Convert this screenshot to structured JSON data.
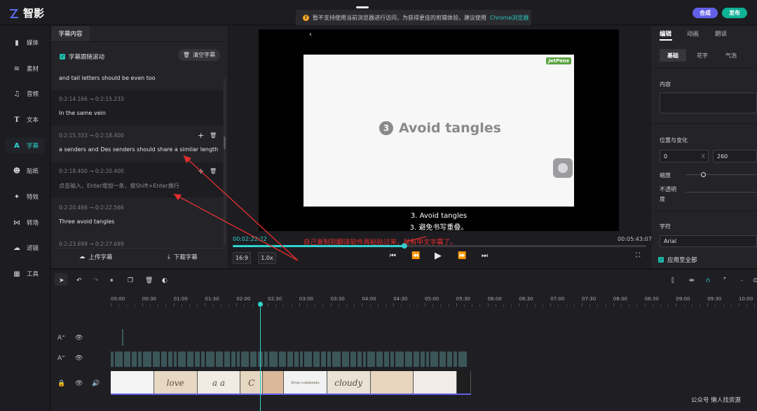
{
  "app": {
    "name": "智影"
  },
  "header": {
    "notice": "暂不支持使用当前浏览器进行访问，为获得更佳的剪辑体验，建议使用",
    "notice_link": "Chrome浏览器",
    "compose_label": "合成",
    "publish_label": "发布"
  },
  "nav": [
    {
      "label": "媒体",
      "icon": "folder-icon",
      "glyph": "▮"
    },
    {
      "label": "素材",
      "icon": "layers-icon",
      "glyph": "≋"
    },
    {
      "label": "音频",
      "icon": "music-icon",
      "glyph": "♫"
    },
    {
      "label": "文本",
      "icon": "text-icon",
      "glyph": "T"
    },
    {
      "label": "字幕",
      "icon": "subtitle-icon",
      "glyph": "A"
    },
    {
      "label": "贴纸",
      "icon": "sticker-icon",
      "glyph": "☻"
    },
    {
      "label": "特效",
      "icon": "sparkle-icon",
      "glyph": "✦"
    },
    {
      "label": "转场",
      "icon": "transition-icon",
      "glyph": "⋈"
    },
    {
      "label": "滤镜",
      "icon": "filter-icon",
      "glyph": "☁"
    },
    {
      "label": "工具",
      "icon": "grid-icon",
      "glyph": "▦"
    }
  ],
  "subtitles": {
    "tab": "字幕内容",
    "autoscroll": "字幕跟随滚动",
    "clear": "清空字幕",
    "cues": [
      {
        "time": "",
        "text": "and tail letters should be even too"
      },
      {
        "time": "0:2:14.166  →  0:2:15.233",
        "text": "In the same vein"
      },
      {
        "time": "0:2:15.333  →  0:2:18.400",
        "text": "a senders and Des senders should share a similar length"
      },
      {
        "time": "0:2:18.400  →  0:2:20.400",
        "text": "点击输入，Enter增加一条，按Shift+Enter换行"
      },
      {
        "time": "0:2:20.466  →  0:2:22.566",
        "text": "Three avoid tangles"
      },
      {
        "time": "0:2:23.699  →  0:2:27.699",
        "text": ""
      }
    ],
    "upload": "上传字幕",
    "download": "下载字幕"
  },
  "player": {
    "slide_brand": "JetPens",
    "slide_number": "3",
    "slide_title": "Avoid tangles",
    "caption_en": "3. Avoid tangles",
    "caption_zh": "3. 避免书写重叠。",
    "current_time": "00:02:22:22",
    "total_time": "00:05:43:07",
    "aspect": "16:9",
    "speed": "1.0x",
    "progress": 0.415
  },
  "annotation": "自己复制到翻译软件再粘贴过来，就有中文字幕了。",
  "right": {
    "tabs": [
      "编辑",
      "动画",
      "朗读"
    ],
    "segments": [
      "基础",
      "花字",
      "气泡"
    ],
    "content_label": "内容",
    "position_label": "位置与变化",
    "x_value": "0",
    "x_axis": "X",
    "y_value": "260",
    "scale_label": "缩放",
    "opacity_label_1": "不透明",
    "opacity_label_2": "度",
    "font_label": "字符",
    "font_value": "Arial",
    "apply_all": "应用至全部"
  },
  "timeline": {
    "ticks": [
      "00:00",
      "00:30",
      "01:00",
      "01:30",
      "02:00",
      "02:30",
      "03:00",
      "03:30",
      "04:00",
      "04:30",
      "05:00",
      "05:30",
      "06:00",
      "06:30",
      "07:00",
      "07:30",
      "08:00",
      "08:30",
      "09:00",
      "09:30",
      "10:00"
    ],
    "thumbs": [
      "",
      "love",
      "a a",
      "C",
      "",
      "Drop comments",
      "cloudy",
      "",
      "",
      ""
    ]
  },
  "watermark": "公众号  懒人找资源"
}
